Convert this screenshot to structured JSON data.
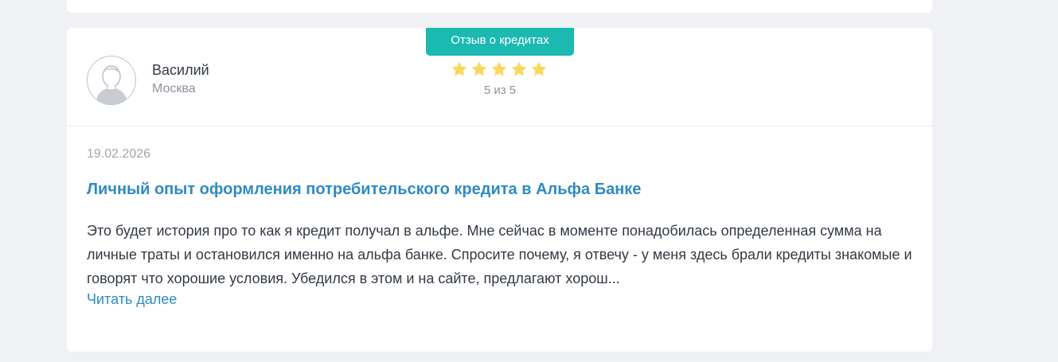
{
  "review": {
    "badge_label": "Отзыв о кредитах",
    "author": {
      "name": "Василий",
      "city": "Москва",
      "avatar_icon": "user-avatar-icon"
    },
    "rating": {
      "value": 5,
      "max": 5,
      "text": "5 из 5",
      "star_icon": "star-icon",
      "star_color": "#fbd75a"
    },
    "date": "19.02.2026",
    "title": "Личный опыт оформления потребительского кредита в Альфа Банке",
    "text": "Это будет история про то как я кредит получал в альфе. Мне сейчас в моменте понадобилась определенная сумма на личные траты и остановился именно на альфа банке. Спросите почему, я отвечу - у меня здесь брали кредиты знакомые и говорят что хорошие условия. Убедился в этом и на сайте, предлагают хорош...",
    "read_more_label": "Читать далее"
  },
  "colors": {
    "badge": "#1cb9b0",
    "link": "#2e8bc0",
    "background": "#eff1f4"
  }
}
